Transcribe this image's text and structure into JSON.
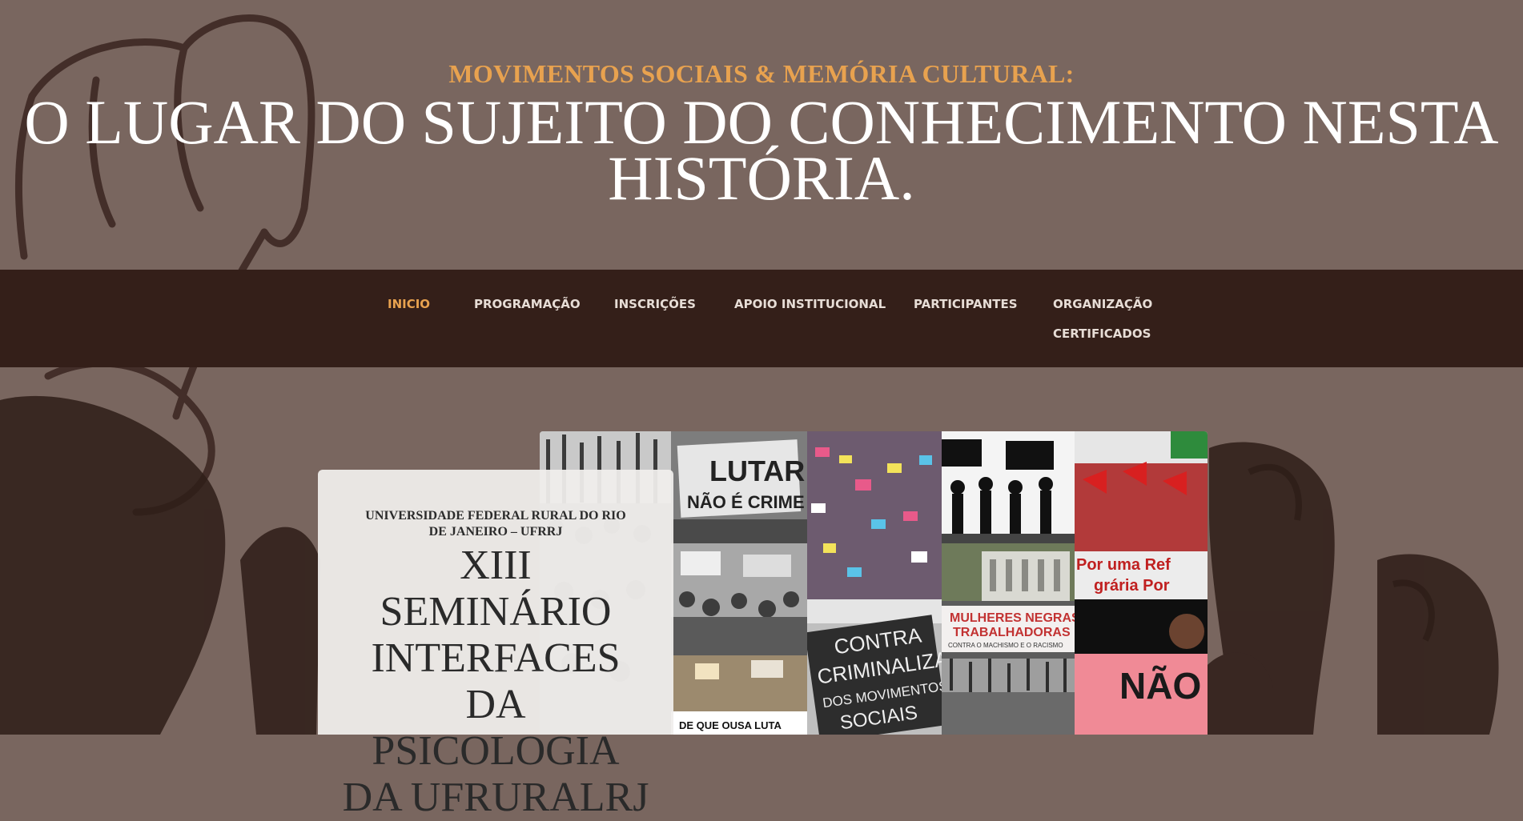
{
  "header": {
    "kicker": "MOVIMENTOS SOCIAIS & MEMÓRIA CULTURAL:",
    "headline": "O LUGAR DO SUJEITO DO CONHECIMENTO NESTA HISTÓRIA."
  },
  "nav": {
    "items": [
      {
        "label": "INICIO",
        "active": true
      },
      {
        "label": "PROGRAMAÇÃO"
      },
      {
        "label": "INSCRIÇÕES"
      },
      {
        "label": "APOIO INSTITUCIONAL"
      },
      {
        "label": "PARTICIPANTES"
      },
      {
        "label": "ORGANIZAÇÃO"
      },
      {
        "label": "CERTIFICADOS"
      }
    ],
    "active_color": "#e8a24f"
  },
  "card": {
    "institution": "UNIVERSIDADE FEDERAL RURAL DO RIO DE JANEIRO – UFRRJ",
    "title": "XIII SEMINÁRIO INTERFACES DA PSICOLOGIA DA UFRURALRJ"
  },
  "collage": {
    "signs": {
      "lutar": "LUTAR",
      "nao_e_crime": "NÃO É CRIME",
      "contra": "CONTRA",
      "criminaliza": "CRIMINALIZA",
      "dos_movimentos": "DOS MOVIMENTOS",
      "sociais": "SOCIAIS",
      "mulheres_negras": "MULHERES NEGRAS",
      "trabalhadoras": "TRABALHADORAS",
      "contra_machismo": "CONTRA O MACHISMO E O RACISMO",
      "por_uma_ref": "Por uma Ref",
      "agraria_por": "grária Por",
      "nao": "NÃO",
      "ousa_luta": "DE QUE OUSA LUTA"
    }
  },
  "colors": {
    "background": "#79665f",
    "navbar": "#341f19",
    "accent": "#e8a24f"
  }
}
